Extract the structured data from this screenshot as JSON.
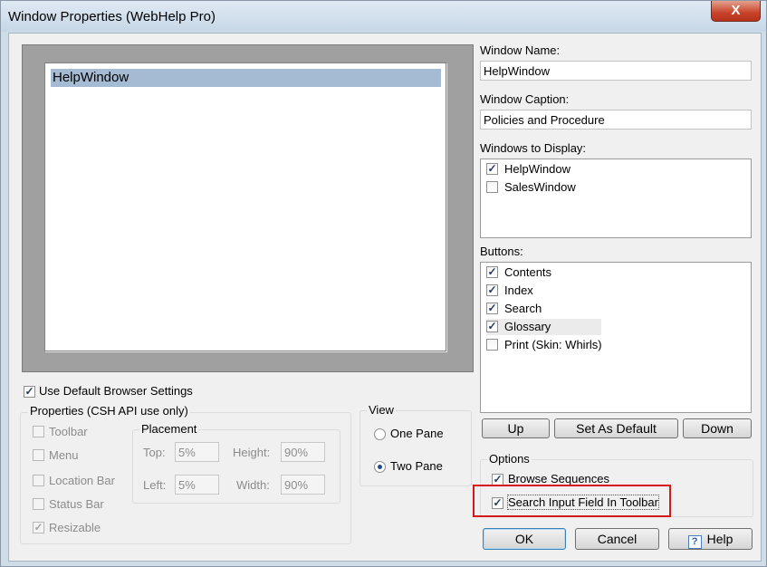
{
  "window": {
    "title": "Window Properties (WebHelp Pro)",
    "close_label": "X"
  },
  "preview": {
    "item": "HelpWindow"
  },
  "left": {
    "use_default_label": "Use Default Browser Settings",
    "use_default_checked": true,
    "properties_title": "Properties (CSH API use only)",
    "toolbar_label": "Toolbar",
    "menu_label": "Menu",
    "location_bar_label": "Location Bar",
    "status_bar_label": "Status Bar",
    "resizable_label": "Resizable",
    "resizable_checked": true,
    "placement_title": "Placement",
    "top_label": "Top:",
    "top_value": "5%",
    "height_label": "Height:",
    "height_value": "90%",
    "left_label": "Left:",
    "left_value": "5%",
    "width_label": "Width:",
    "width_value": "90%"
  },
  "view": {
    "title": "View",
    "one_pane_label": "One Pane",
    "two_pane_label": "Two Pane",
    "selected": "Two Pane"
  },
  "right": {
    "window_name_label": "Window Name:",
    "window_name_value": "HelpWindow",
    "window_caption_label": "Window Caption:",
    "window_caption_value": "Policies and Procedure",
    "windows_to_display_label": "Windows to Display:",
    "windows": [
      {
        "label": "HelpWindow",
        "checked": true
      },
      {
        "label": "SalesWindow",
        "checked": false
      }
    ],
    "buttons_label": "Buttons:",
    "buttons": [
      {
        "label": "Contents",
        "checked": true
      },
      {
        "label": "Index",
        "checked": true
      },
      {
        "label": "Search",
        "checked": true
      },
      {
        "label": "Glossary",
        "checked": true
      },
      {
        "label": "Print (Skin: Whirls)",
        "checked": false
      }
    ],
    "up_label": "Up",
    "set_default_label": "Set As Default",
    "down_label": "Down",
    "options_title": "Options",
    "browse_sequences_label": "Browse Sequences",
    "browse_sequences_checked": true,
    "search_input_label": "Search Input Field In Toolbar",
    "search_input_checked": true
  },
  "footer": {
    "ok_label": "OK",
    "cancel_label": "Cancel",
    "help_label": "Help"
  },
  "colors": {
    "highlight": "#d51a1a",
    "selection": "#a4bbd3",
    "check": "#2a3a5a"
  }
}
